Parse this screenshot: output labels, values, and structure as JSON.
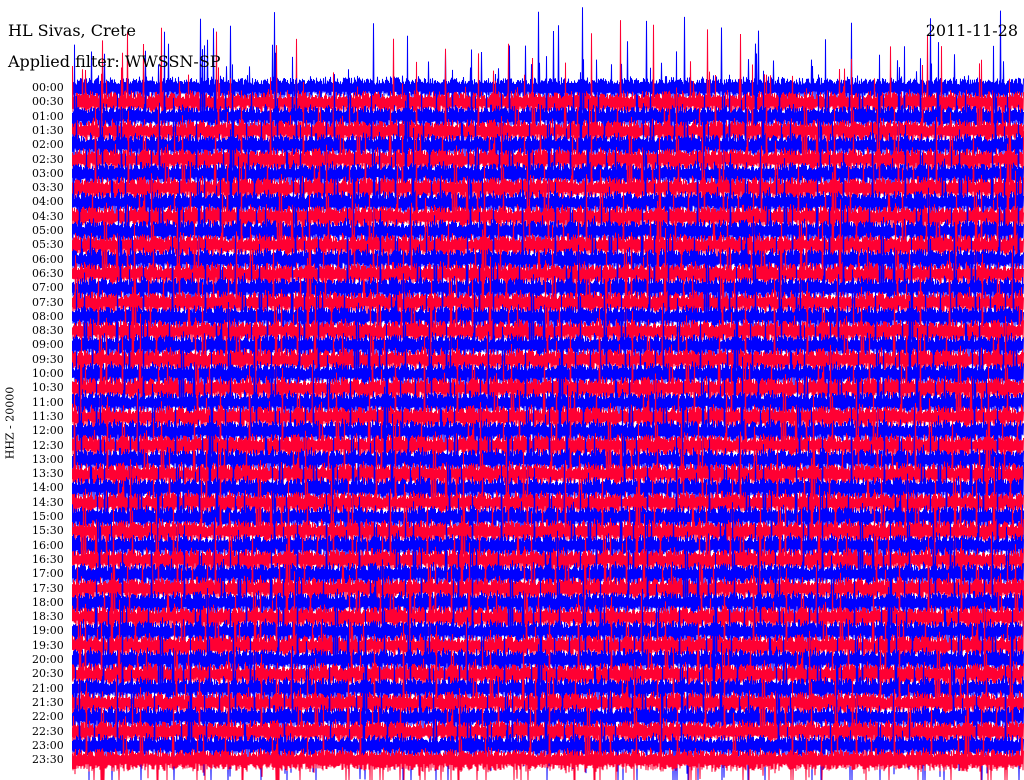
{
  "header": {
    "title": "HL Sivas, Crete",
    "filter": "Applied filter: WWSSN-SP",
    "date": "2011-11-28"
  },
  "chart_data": {
    "type": "line",
    "title": "HL Sivas, Crete",
    "subtitle": "Applied filter: WWSSN-SP",
    "ylabel": "HHZ - 20000",
    "date": "2011-11-28",
    "alternating_colors": [
      "#0000ff",
      "#ff0033"
    ],
    "tick_labels": [
      "00:00",
      "00:30",
      "01:00",
      "01:30",
      "02:00",
      "02:30",
      "03:00",
      "03:30",
      "04:00",
      "04:30",
      "05:00",
      "05:30",
      "06:00",
      "06:30",
      "07:00",
      "07:30",
      "08:00",
      "08:30",
      "09:00",
      "09:30",
      "10:00",
      "10:30",
      "11:00",
      "11:30",
      "12:00",
      "12:30",
      "13:00",
      "13:30",
      "14:00",
      "14:30",
      "15:00",
      "15:30",
      "16:00",
      "16:30",
      "17:00",
      "17:30",
      "18:00",
      "18:30",
      "19:00",
      "19:30",
      "20:00",
      "20:30",
      "21:00",
      "21:30",
      "22:00",
      "22:30",
      "23:00",
      "23:30"
    ]
  }
}
